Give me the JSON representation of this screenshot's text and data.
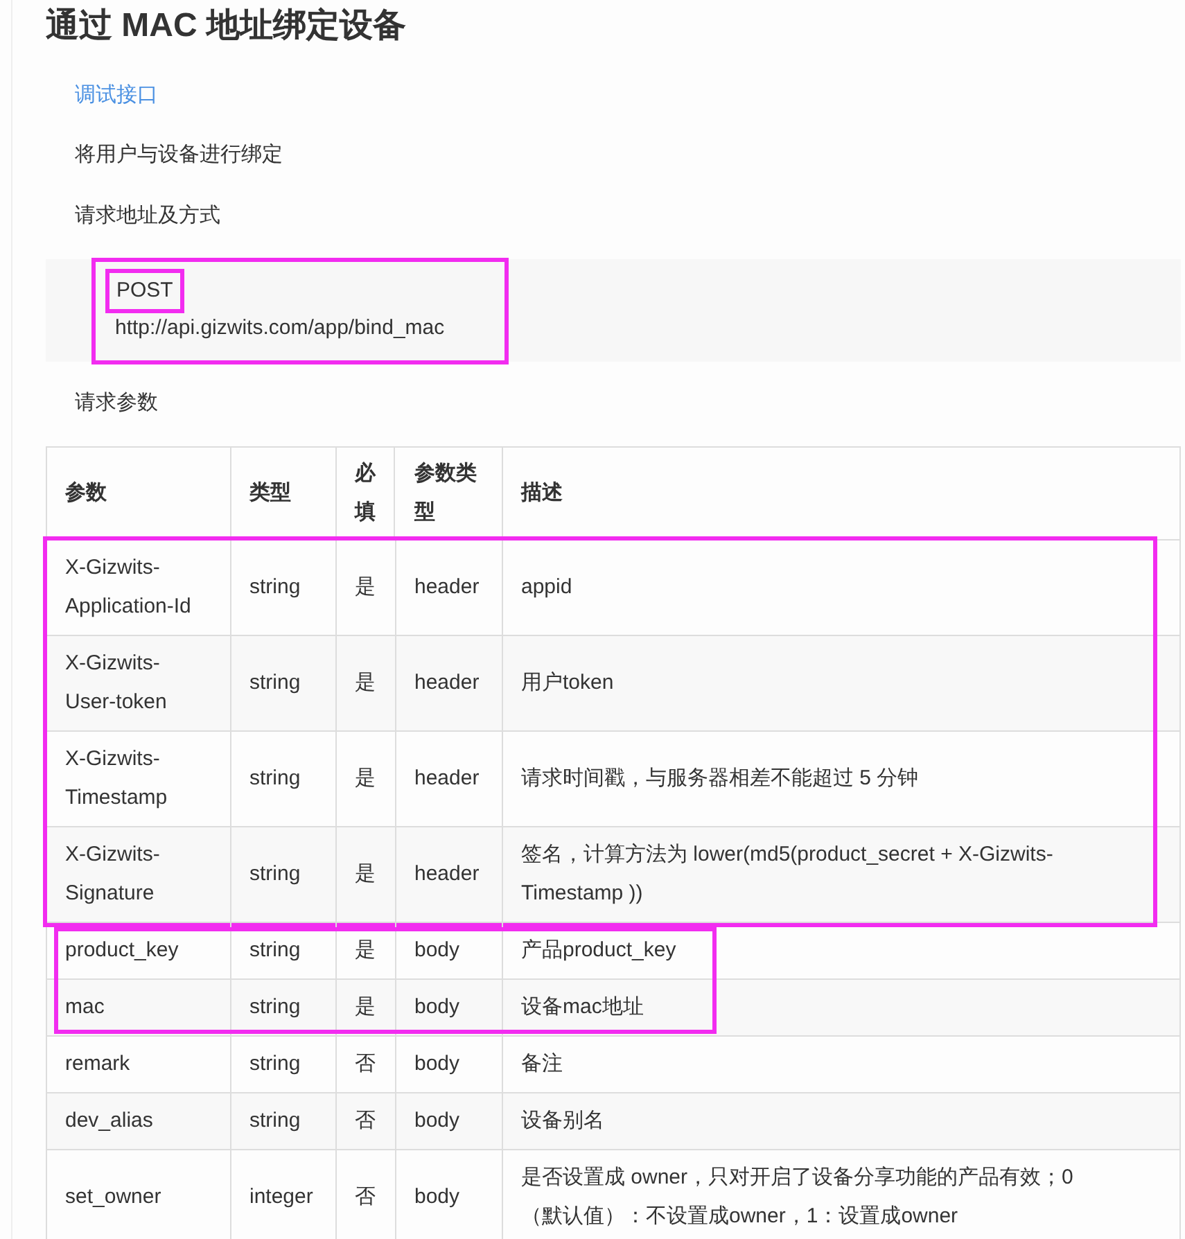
{
  "title": "通过 MAC 地址绑定设备",
  "debug_link": "调试接口",
  "description": "将用户与设备进行绑定",
  "request_heading": "请求地址及方式",
  "request": {
    "outlined": true,
    "method": "POST",
    "method_outlined": true,
    "url": "http://api.gizwits.com/app/bind_mac"
  },
  "params_heading": "请求参数",
  "table": {
    "columns": [
      "参数",
      "类型",
      "必填",
      "参数类型",
      "描述"
    ],
    "row_groups": [
      {
        "outlined": true,
        "outline_partial": false,
        "rows": [
          [
            "X-Gizwits-Application-Id",
            "string",
            "是",
            "header",
            "appid"
          ],
          [
            "X-Gizwits-User-token",
            "string",
            "是",
            "header",
            "用户token"
          ],
          [
            "X-Gizwits-Timestamp",
            "string",
            "是",
            "header",
            "请求时间戳，与服务器相差不能超过 5 分钟"
          ],
          [
            "X-Gizwits-Signature",
            "string",
            "是",
            "header",
            "签名，计算方法为 lower(md5(product_secret + X-Gizwits-Timestamp ))"
          ]
        ]
      },
      {
        "outlined": true,
        "outline_partial": true,
        "rows": [
          [
            "product_key",
            "string",
            "是",
            "body",
            "产品product_key"
          ],
          [
            "mac",
            "string",
            "是",
            "body",
            "设备mac地址"
          ]
        ]
      },
      {
        "outlined": false,
        "rows": [
          [
            "remark",
            "string",
            "否",
            "body",
            "备注"
          ],
          [
            "dev_alias",
            "string",
            "否",
            "body",
            "设备别名"
          ],
          [
            "set_owner",
            "integer",
            "否",
            "body",
            "是否设置成 owner，只对开启了设备分享功能的产品有效；0（默认值）：不设置成owner，1：设置成owner"
          ]
        ]
      }
    ]
  }
}
